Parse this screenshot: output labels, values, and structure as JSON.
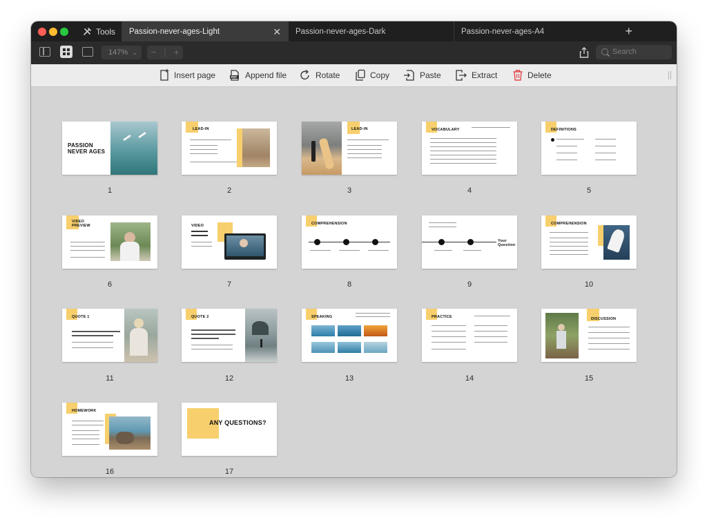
{
  "window": {
    "tools_label": "Tools",
    "tabs": [
      {
        "label": "Passion-never-ages-Light",
        "active": true
      },
      {
        "label": "Passion-never-ages-Dark",
        "active": false
      },
      {
        "label": "Passion-never-ages-A4",
        "active": false
      }
    ],
    "add_tab": "+"
  },
  "toolbar": {
    "zoom_value": "147%",
    "zoom_out": "−",
    "zoom_in": "+",
    "search_placeholder": "Search"
  },
  "actions": [
    {
      "label": "Insert page",
      "icon": "insert-page-icon"
    },
    {
      "label": "Append file",
      "icon": "append-file-icon"
    },
    {
      "label": "Rotate",
      "icon": "rotate-icon"
    },
    {
      "label": "Copy",
      "icon": "copy-icon"
    },
    {
      "label": "Paste",
      "icon": "paste-icon"
    },
    {
      "label": "Extract",
      "icon": "extract-icon"
    },
    {
      "label": "Delete",
      "icon": "trash-icon"
    }
  ],
  "pages": [
    {
      "number": "1",
      "title": "PASSION\nNEVER AGES"
    },
    {
      "number": "2",
      "title": "LEAD-IN"
    },
    {
      "number": "3",
      "title": "LEAD-IN"
    },
    {
      "number": "4",
      "title": "VOCABULARY"
    },
    {
      "number": "5",
      "title": "DEFINITIONS"
    },
    {
      "number": "6",
      "title": "VIDEO\nPREVIEW"
    },
    {
      "number": "7",
      "title": "VIDEO"
    },
    {
      "number": "8",
      "title": "COMPREHENSION"
    },
    {
      "number": "9",
      "title": "Your\nQuestion"
    },
    {
      "number": "10",
      "title": "COMPREHENSION"
    },
    {
      "number": "11",
      "title": "QUOTE 1"
    },
    {
      "number": "12",
      "title": "QUOTE 2"
    },
    {
      "number": "13",
      "title": "SPEAKING"
    },
    {
      "number": "14",
      "title": "PRACTICE"
    },
    {
      "number": "15",
      "title": "DISCUSSION"
    },
    {
      "number": "16",
      "title": "HOMEWORK"
    },
    {
      "number": "17",
      "title": "ANY QUESTIONS?"
    }
  ],
  "colors": {
    "accent_yellow": "#f7cf6c",
    "delete_red": "#e0464b",
    "titlebar": "#1f1f1f",
    "canvas": "#d4d4d4"
  }
}
